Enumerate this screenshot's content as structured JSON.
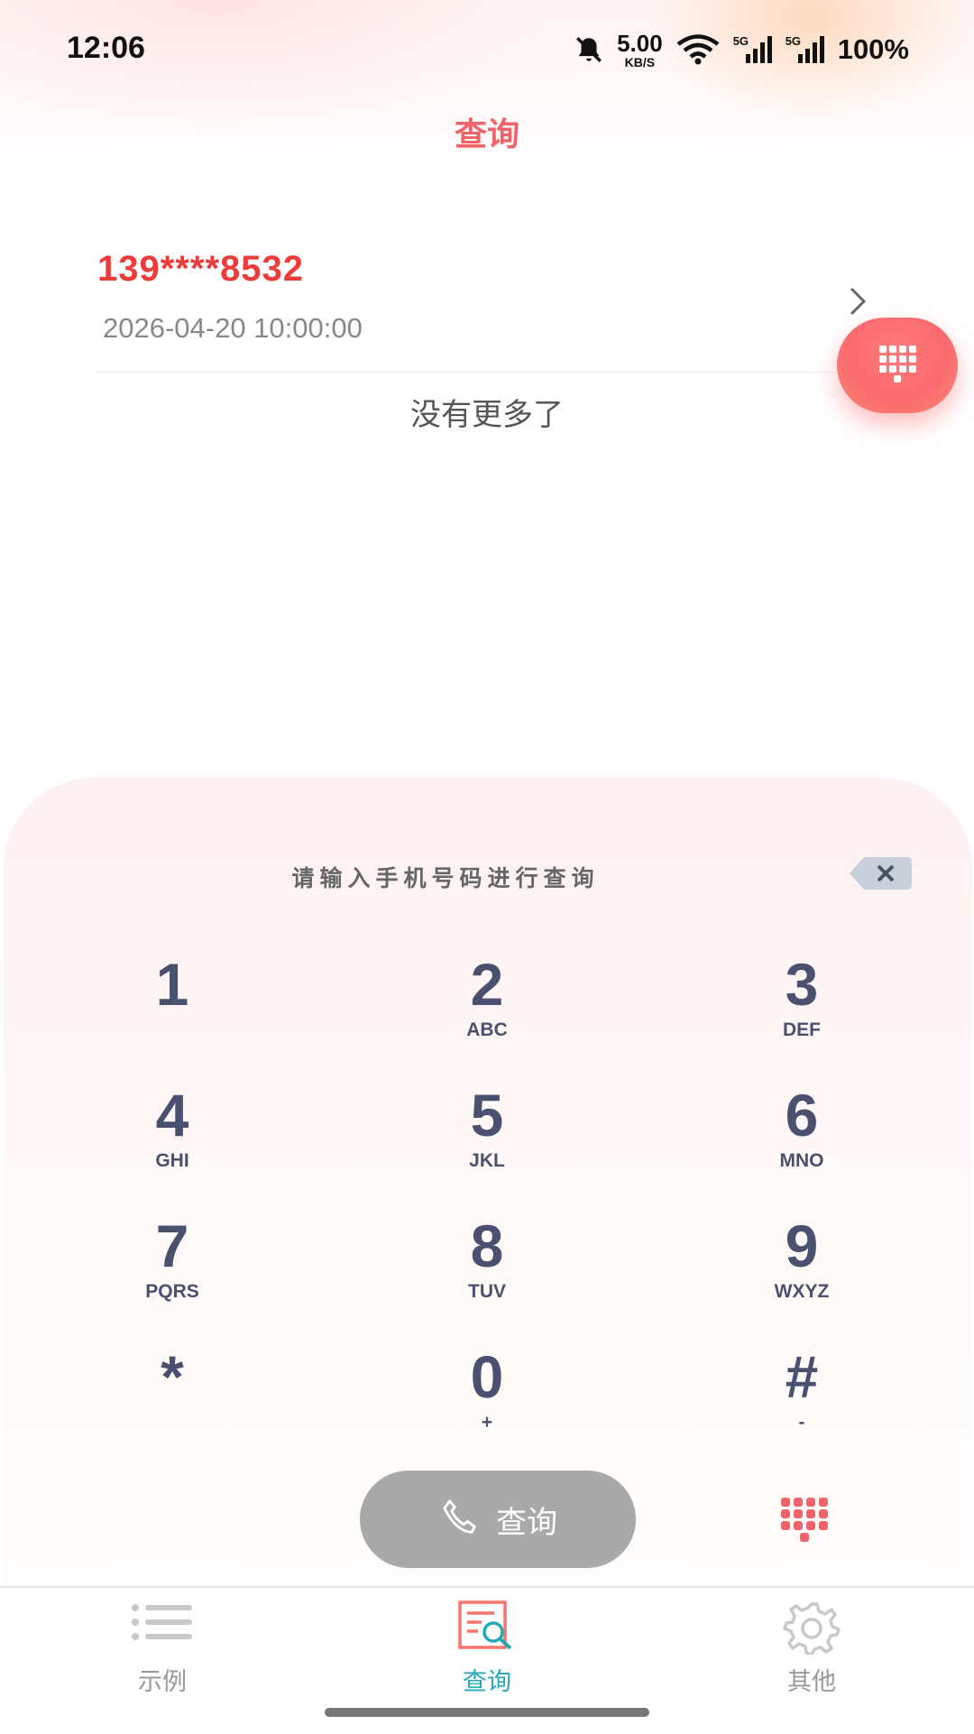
{
  "status_bar": {
    "time": "12:06",
    "net_speed_value": "5.00",
    "net_speed_unit": "KB/S",
    "signal1_label": "5G",
    "signal2_label": "5G",
    "battery": "100%"
  },
  "header": {
    "title": "查询"
  },
  "records": [
    {
      "number": "139****8532",
      "time": "2026-04-20 10:00:00"
    }
  ],
  "list_footer": "没有更多了",
  "keypad": {
    "prompt": "请输入手机号码进行查询",
    "keys": [
      {
        "digit": "1",
        "letters": ""
      },
      {
        "digit": "2",
        "letters": "ABC"
      },
      {
        "digit": "3",
        "letters": "DEF"
      },
      {
        "digit": "4",
        "letters": "GHI"
      },
      {
        "digit": "5",
        "letters": "JKL"
      },
      {
        "digit": "6",
        "letters": "MNO"
      },
      {
        "digit": "7",
        "letters": "PQRS"
      },
      {
        "digit": "8",
        "letters": "TUV"
      },
      {
        "digit": "9",
        "letters": "WXYZ"
      },
      {
        "digit": "*",
        "letters": ""
      },
      {
        "digit": "0",
        "letters": "+"
      },
      {
        "digit": "#",
        "letters": "-"
      }
    ],
    "query_button_label": "查询"
  },
  "bottom_nav": {
    "tabs": [
      {
        "label": "示例",
        "icon": "list-icon",
        "active": false
      },
      {
        "label": "查询",
        "icon": "search-document-icon",
        "active": true
      },
      {
        "label": "其他",
        "icon": "gear-icon",
        "active": false
      }
    ]
  },
  "colors": {
    "accent_red": "#ee3b3b",
    "title_pink": "#f06469",
    "active_tab": "#24a9b6",
    "key_text": "#4a5170",
    "disabled_button": "#a9a9a9"
  }
}
